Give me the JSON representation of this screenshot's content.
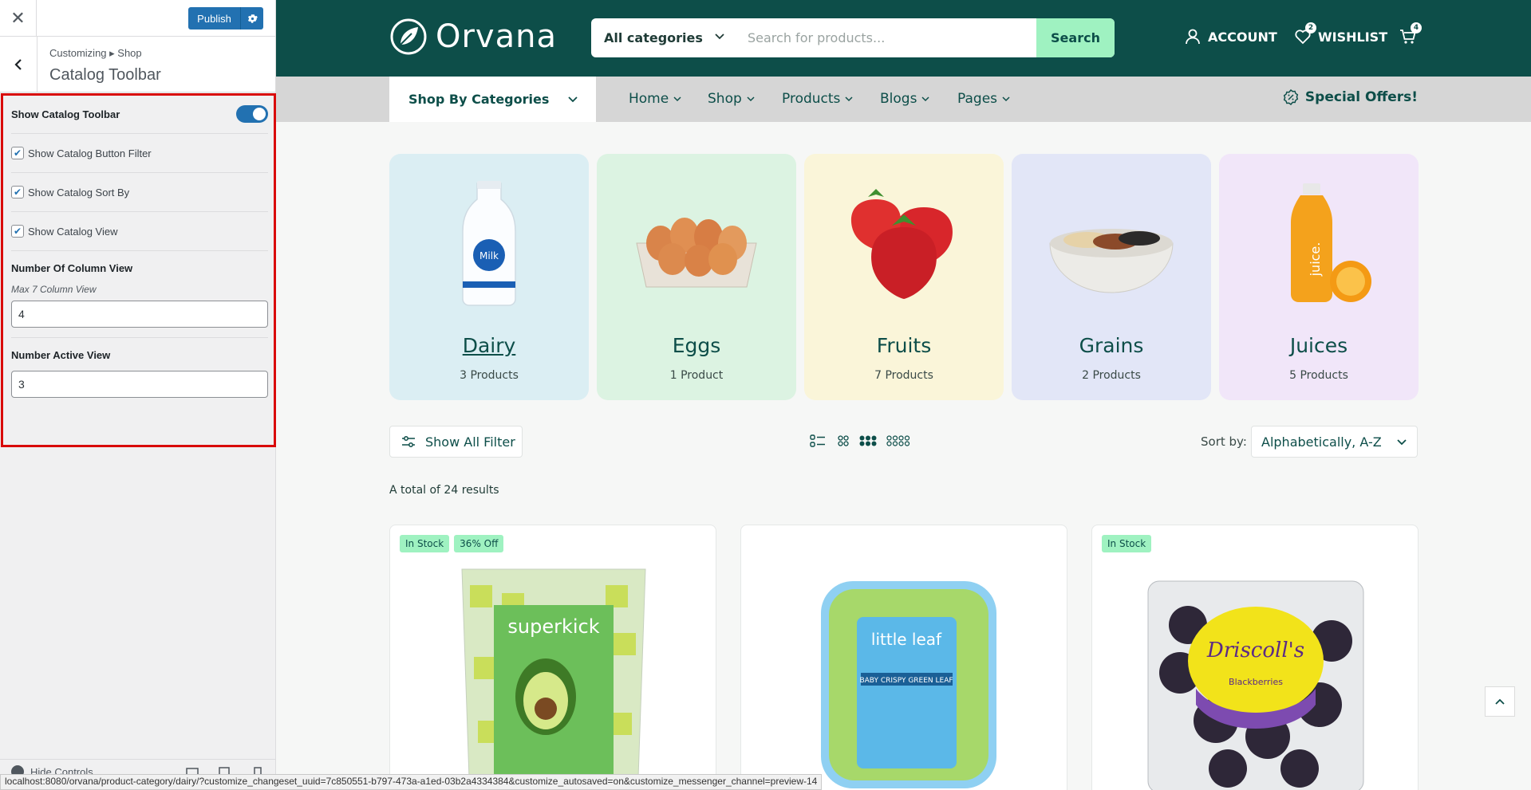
{
  "customizer": {
    "close_icon": "close-icon",
    "publish_label": "Publish",
    "breadcrumb": "Customizing ▸ Shop",
    "section_title": "Catalog Toolbar",
    "controls": {
      "show_toolbar_label": "Show Catalog Toolbar",
      "show_toolbar_on": true,
      "cb_filter_label": "Show Catalog Button Filter",
      "cb_sort_label": "Show Catalog Sort By",
      "cb_view_label": "Show Catalog View",
      "columns_label": "Number Of Column View",
      "columns_desc": "Max 7 Column View",
      "columns_value": "4",
      "active_label": "Number Active View",
      "active_value": "3"
    },
    "footer": {
      "hide_controls": "Hide Controls"
    },
    "highlight_color": "#d90a0a"
  },
  "store": {
    "brand": "Orvana",
    "brand_color": "#0d4e49",
    "accent_color": "#9ff2c1",
    "search": {
      "category": "All categories",
      "placeholder": "Search for products...",
      "button": "Search"
    },
    "header_links": {
      "account": "ACCOUNT",
      "wishlist": "WISHLIST",
      "wishlist_count": "2",
      "cart_count": "4"
    },
    "nav": {
      "shop_by": "Shop By Categories",
      "items": [
        "Home",
        "Shop",
        "Products",
        "Blogs",
        "Pages"
      ],
      "special": "Special Offers!"
    },
    "categories": [
      {
        "name": "Dairy",
        "count": "3 Products",
        "bg": "#dbeef3"
      },
      {
        "name": "Eggs",
        "count": "1 Product",
        "bg": "#dcf3e2"
      },
      {
        "name": "Fruits",
        "count": "7 Products",
        "bg": "#faf5d9"
      },
      {
        "name": "Grains",
        "count": "2 Products",
        "bg": "#e2e6f7"
      },
      {
        "name": "Juices",
        "count": "5 Products",
        "bg": "#f1e6f9"
      }
    ],
    "toolbar": {
      "filter": "Show All Filter",
      "sort_label": "Sort by:",
      "sort_value": "Alphabetically, A-Z",
      "active_view": 3
    },
    "results": "A total of 24 results",
    "products": [
      {
        "tags": [
          "In Stock",
          "36% Off"
        ],
        "image": "avocado-pack"
      },
      {
        "tags": [],
        "image": "lettuce-box"
      },
      {
        "tags": [
          "In Stock"
        ],
        "image": "blackberries-box"
      }
    ]
  },
  "statusbar": "localhost:8080/orvana/product-category/dairy/?customize_changeset_uuid=7c850551-b797-473a-a1ed-03b2a4334384&customize_autosaved=on&customize_messenger_channel=preview-14"
}
